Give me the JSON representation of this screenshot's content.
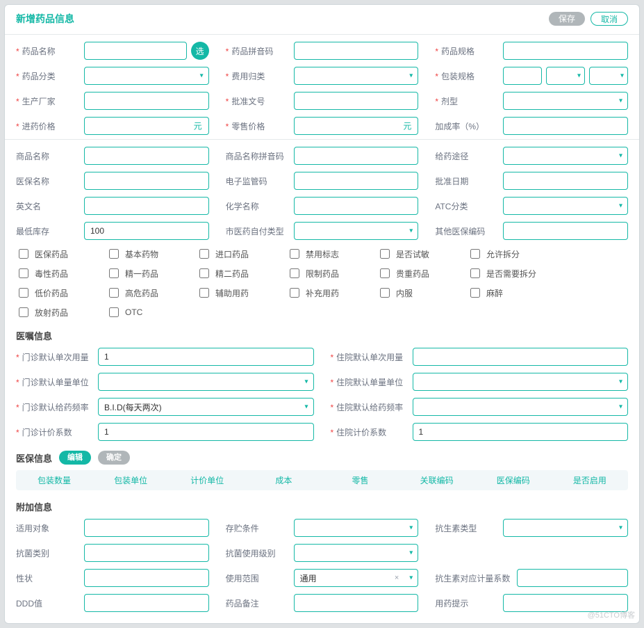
{
  "header": {
    "title": "新增药品信息",
    "save": "保存",
    "cancel": "取消"
  },
  "basic": {
    "name_label": "药品名称",
    "pick_label": "选",
    "pinyin_label": "药品拼音码",
    "spec_label": "药品规格",
    "cat_label": "药品分类",
    "fee_label": "费用归类",
    "pkg_label": "包装规格",
    "mfr_label": "生产厂家",
    "approval_label": "批准文号",
    "dosform_label": "剂型",
    "inprice_label": "进药价格",
    "inprice_suffix": "元",
    "retail_label": "零售价格",
    "retail_suffix": "元",
    "markup_label": "加成率（%）"
  },
  "ext": {
    "trade_label": "商品名称",
    "trade_py_label": "商品名称拼音码",
    "route_label": "给药途径",
    "ins_label": "医保名称",
    "ecode_label": "电子监管码",
    "appr_date_label": "批准日期",
    "en_label": "英文名",
    "chem_label": "化学名称",
    "atc_label": "ATC分类",
    "minstock_label": "最低库存",
    "minstock_value": "100",
    "selfpay_label": "市医药自付类型",
    "other_ins_label": "其他医保编码"
  },
  "checks": [
    "医保药品",
    "基本药物",
    "进口药品",
    "禁用标志",
    "是否试敏",
    "允许拆分",
    "毒性药品",
    "精一药品",
    "精二药品",
    "限制药品",
    "贵重药品",
    "是否需要拆分",
    "低价药品",
    "高危药品",
    "辅助用药",
    "补充用药",
    "内服",
    "麻醉",
    "放射药品",
    "OTC"
  ],
  "order": {
    "title": "医嘱信息",
    "op_dose_label": "门诊默认单次用量",
    "op_dose_value": "1",
    "ip_dose_label": "住院默认单次用量",
    "op_unit_label": "门诊默认单量单位",
    "ip_unit_label": "住院默认单量单位",
    "op_freq_label": "门诊默认给药频率",
    "op_freq_value": "B.I.D(每天两次)",
    "ip_freq_label": "住院默认给药频率",
    "op_coef_label": "门诊计价系数",
    "op_coef_value": "1",
    "ip_coef_label": "住院计价系数",
    "ip_coef_value": "1"
  },
  "ins": {
    "title": "医保信息",
    "edit": "编辑",
    "ok": "确定",
    "cols": [
      "包装数量",
      "包装单位",
      "计价单位",
      "成本",
      "零售",
      "关联编码",
      "医保编码",
      "是否启用"
    ]
  },
  "addon": {
    "title": "附加信息",
    "target_label": "适用对象",
    "storage_label": "存贮条件",
    "abx_type_label": "抗生素类型",
    "abx_cat_label": "抗菌类别",
    "abx_level_label": "抗菌使用级别",
    "character_label": "性状",
    "scope_label": "使用范围",
    "scope_value": "通用",
    "abx_coef_label": "抗生素对应计量系数",
    "ddd_label": "DDD值",
    "remark_label": "药品备注",
    "tip_label": "用药提示"
  },
  "watermark": "@51CTO博客"
}
